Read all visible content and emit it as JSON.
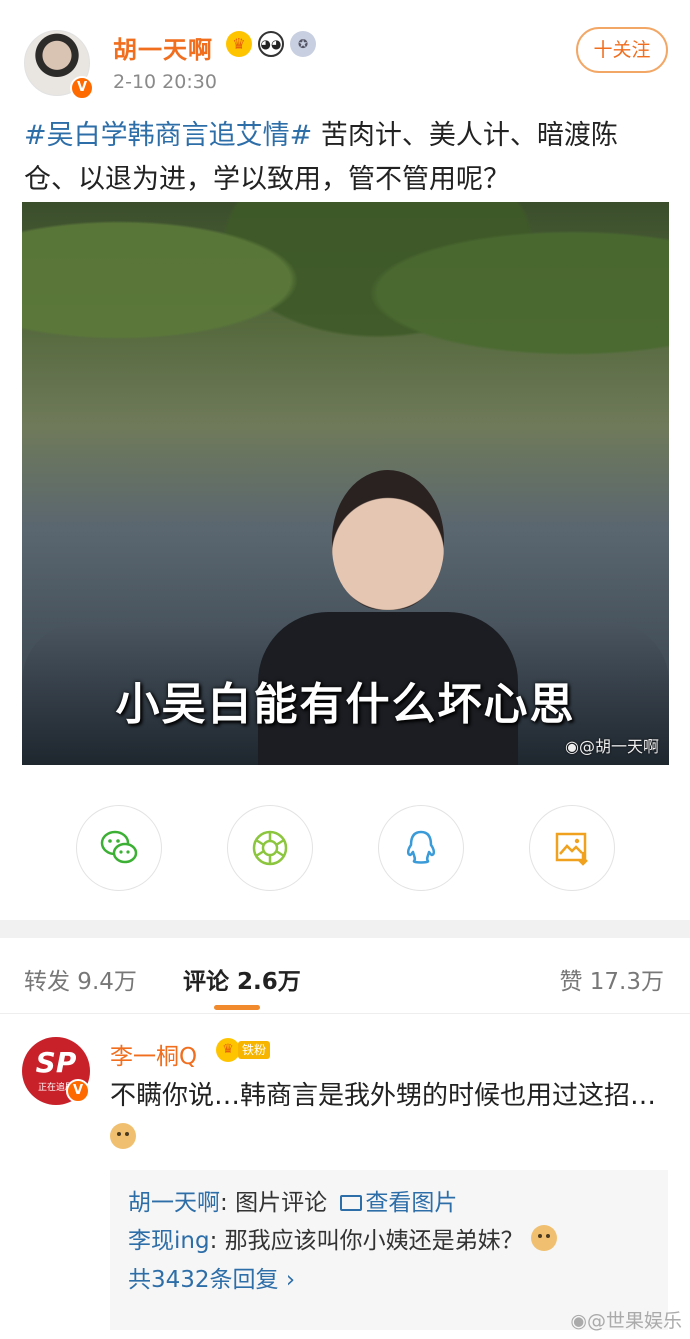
{
  "post": {
    "author": "胡一天啊",
    "time": "2-10 20:30",
    "follow_label": "十关注",
    "hashtag": "#吴白学韩商言追艾情#",
    "text": " 苦肉计、美人计、暗渡陈仓、以退为进，学以致用，管不管用呢？",
    "image_caption": "小吴白能有什么坏心思",
    "image_watermark": "@胡一天啊",
    "verified_mark": "V"
  },
  "share": {
    "items": [
      {
        "icon": "wechat-icon",
        "color": "#3cb034"
      },
      {
        "icon": "moments-icon",
        "color": "#8cc63f"
      },
      {
        "icon": "qq-icon",
        "color": "#3b9bd8"
      },
      {
        "icon": "save-image-icon",
        "color": "#f0a21e"
      }
    ]
  },
  "tabs": {
    "repost": "转发 9.4万",
    "comment": "评论 2.6万",
    "like": "赞 17.3万"
  },
  "comment": {
    "author": "李一桐Q",
    "fan_tag": "铁粉",
    "avatar_text": "SP",
    "avatar_sub": "正在追剧",
    "verified_mark": "V",
    "text": "不瞒你说…韩商言是我外甥的时候也用过这招…",
    "replies": [
      {
        "user": "胡一天啊",
        "text": "图片评论 ",
        "link": "查看图片"
      },
      {
        "user": "李现ing",
        "text": "那我应该叫你小姨还是弟妹？"
      }
    ],
    "more_replies": "共3432条回复 ›"
  },
  "page_watermark": "@世果娱乐"
}
